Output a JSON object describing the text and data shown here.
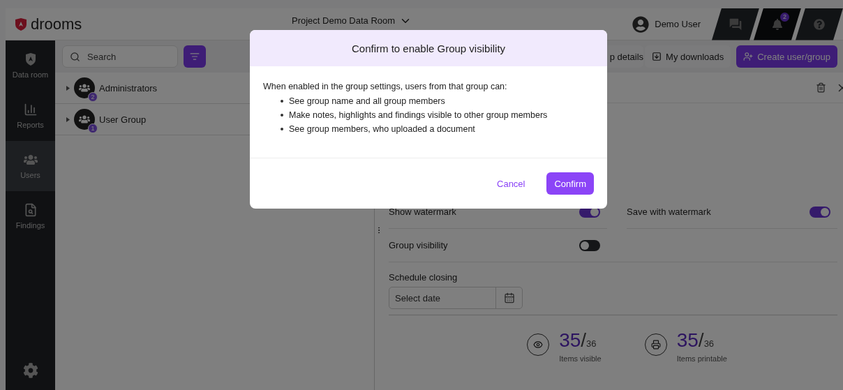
{
  "header": {
    "logo": "drooms",
    "project": "Project Demo Data Room",
    "user": "Demo User",
    "notifications": "2"
  },
  "sidebar": {
    "items": [
      {
        "label": "Data room",
        "kind": "dataroom",
        "selected": false
      },
      {
        "label": "Reports",
        "kind": "reports",
        "selected": false
      },
      {
        "label": "Users",
        "kind": "users",
        "selected": true
      },
      {
        "label": "Findings",
        "kind": "findings",
        "selected": false
      }
    ]
  },
  "toolbar": {
    "search": {
      "placeholder": "Search"
    },
    "buttons": [
      {
        "label": "p details",
        "kind": "plain"
      },
      {
        "label": "My downloads",
        "kind": "download"
      },
      {
        "label": "Create user/group",
        "kind": "primary"
      }
    ]
  },
  "groups": [
    {
      "name": "Administrators",
      "count": "2"
    },
    {
      "name": "User Group",
      "count": "1"
    }
  ],
  "details": {
    "settings": [
      {
        "label": "Show watermark",
        "on": true
      },
      {
        "label": "Save with watermark",
        "on": true
      },
      {
        "label": "Group visibility",
        "on": false
      }
    ],
    "schedule_closing": {
      "label": "Schedule closing",
      "placeholder": "Select date"
    },
    "stats": [
      {
        "value": "35",
        "separator": "/",
        "total": "36",
        "label": "Items visible",
        "kind": "visible"
      },
      {
        "value": "35",
        "separator": "/",
        "total": "36",
        "label": "Items printable",
        "kind": "printable"
      }
    ]
  },
  "dialog": {
    "title": "Confirm to enable Group visibility",
    "intro": "When enabled in the group settings, users from that group can:",
    "bullets": [
      "See group name and all group members",
      "Make notes, highlights and findings visible to other group members",
      "See group members, who uploaded a document"
    ],
    "buttons": [
      {
        "label": "Cancel",
        "kind": "text"
      },
      {
        "label": "Confirm",
        "kind": "primary"
      }
    ]
  }
}
